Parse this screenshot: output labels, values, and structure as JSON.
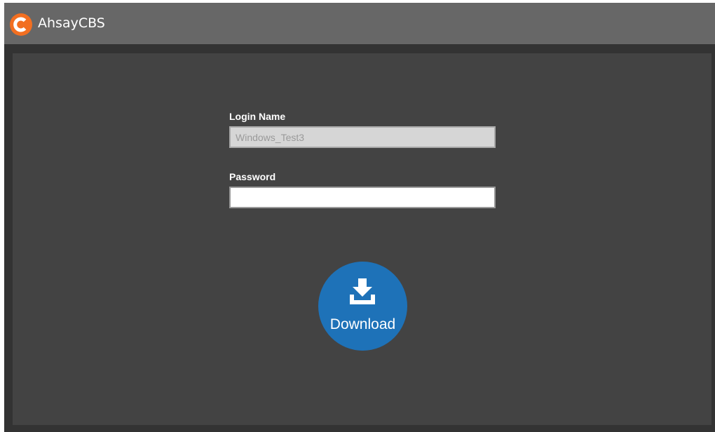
{
  "header": {
    "app_title": "AhsayCBS",
    "logo_icon": "ahsay-c-logo-icon",
    "logo_color": "#f26f21"
  },
  "form": {
    "login_name_label": "Login Name",
    "login_name_value": "Windows_Test3",
    "password_label": "Password",
    "password_value": ""
  },
  "download": {
    "label": "Download",
    "icon": "download-icon",
    "color": "#1e72b8"
  }
}
